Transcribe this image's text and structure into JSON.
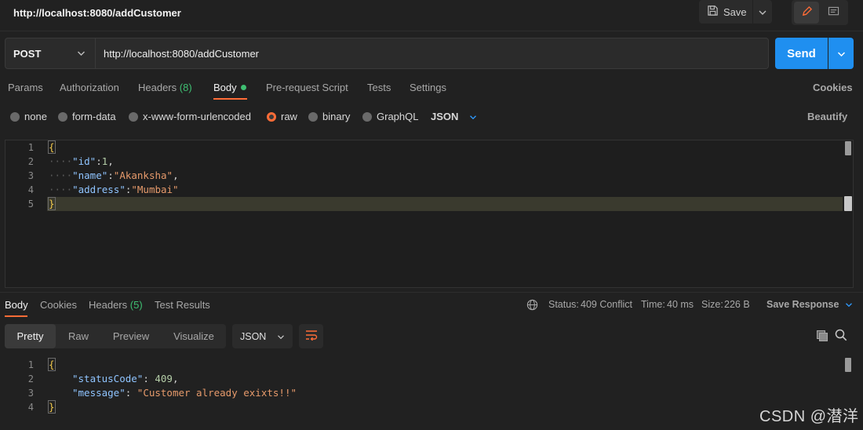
{
  "tab": {
    "title": "http://localhost:8080/addCustomer"
  },
  "toolbar": {
    "save_label": "Save"
  },
  "request": {
    "method": "POST",
    "url": "http://localhost:8080/addCustomer",
    "send_label": "Send"
  },
  "request_tabs": {
    "params": "Params",
    "authorization": "Authorization",
    "headers": "Headers",
    "headers_count": "(8)",
    "body": "Body",
    "prerequest": "Pre-request Script",
    "tests": "Tests",
    "settings": "Settings",
    "cookies": "Cookies"
  },
  "body_types": {
    "none": "none",
    "form_data": "form-data",
    "urlencoded": "x-www-form-urlencoded",
    "raw": "raw",
    "binary": "binary",
    "graphql": "GraphQL",
    "format": "JSON",
    "beautify": "Beautify",
    "selected": "raw"
  },
  "request_body": {
    "line_numbers": [
      "1",
      "2",
      "3",
      "4",
      "5"
    ],
    "open": "{",
    "close": "}",
    "indent": "····",
    "k_id": "\"id\"",
    "v_id": "1",
    "k_name": "\"name\"",
    "v_name": "\"Akanksha\"",
    "k_address": "\"address\"",
    "v_address": "\"Mumbai\"",
    "colon": ":",
    "comma": ","
  },
  "response_tabs": {
    "body": "Body",
    "cookies": "Cookies",
    "headers": "Headers",
    "headers_count": "(5)",
    "test_results": "Test Results"
  },
  "response_status": {
    "status_label": "Status:",
    "status_value": "409 Conflict",
    "time_label": "Time:",
    "time_value": "40 ms",
    "size_label": "Size:",
    "size_value": "226 B",
    "save_response": "Save Response"
  },
  "response_view": {
    "pretty": "Pretty",
    "raw": "Raw",
    "preview": "Preview",
    "visualize": "Visualize",
    "format": "JSON"
  },
  "response_body": {
    "line_numbers": [
      "1",
      "2",
      "3",
      "4"
    ],
    "open": "{",
    "close": "}",
    "k_status": "\"statusCode\"",
    "v_status": "409",
    "k_message": "\"message\"",
    "v_message": "\"Customer already exixts!!\"",
    "colon": ": ",
    "comma": ","
  },
  "watermark": "CSDN @潜洋",
  "colors": {
    "accent": "#ff6c37",
    "send": "#1f8ff0",
    "status_ok": "#3fbf72"
  },
  "icons": [
    "save-icon",
    "chevron-down-icon",
    "pencil-icon",
    "comment-icon",
    "globe-icon",
    "wrap-icon",
    "copy-icon",
    "search-icon"
  ]
}
